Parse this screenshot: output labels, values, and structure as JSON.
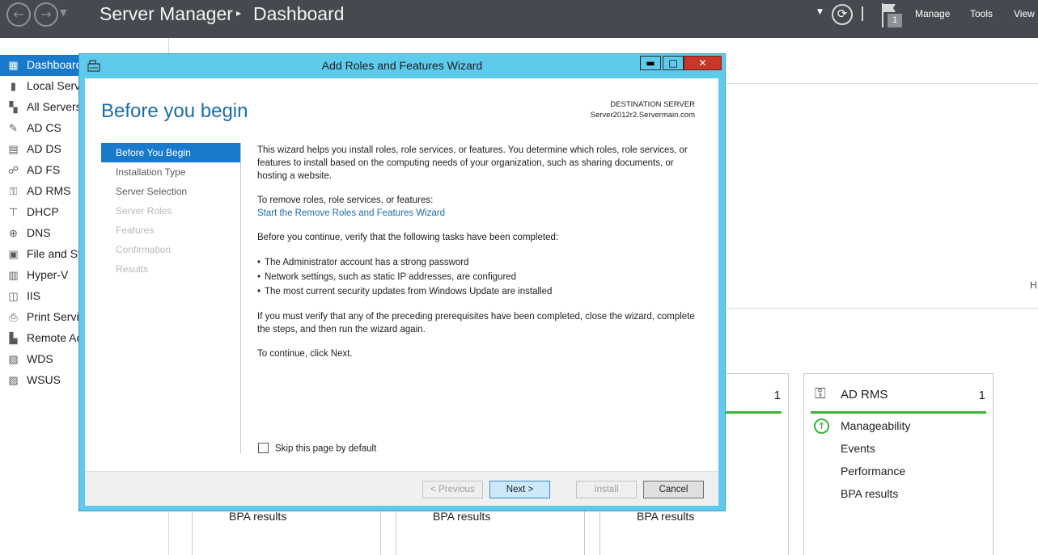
{
  "topbar": {
    "app_title": "Server Manager",
    "separator": "▸",
    "page_title": "Dashboard",
    "notification_count": "1",
    "menu": [
      "Manage",
      "Tools",
      "View"
    ]
  },
  "sidebar": {
    "items": [
      {
        "label": "Dashboard",
        "icon": "dashboard-grid-icon",
        "active": true
      },
      {
        "label": "Local Serve",
        "icon": "local-server-icon"
      },
      {
        "label": "All Servers",
        "icon": "all-servers-icon"
      },
      {
        "label": "AD CS",
        "icon": "ad-cs-icon"
      },
      {
        "label": "AD DS",
        "icon": "ad-ds-icon"
      },
      {
        "label": "AD FS",
        "icon": "ad-fs-icon"
      },
      {
        "label": "AD RMS",
        "icon": "ad-rms-icon"
      },
      {
        "label": "DHCP",
        "icon": "dhcp-icon"
      },
      {
        "label": "DNS",
        "icon": "dns-icon"
      },
      {
        "label": "File and St",
        "icon": "file-storage-icon"
      },
      {
        "label": "Hyper-V",
        "icon": "hyper-v-icon"
      },
      {
        "label": "IIS",
        "icon": "iis-icon"
      },
      {
        "label": "Print Servic",
        "icon": "print-icon"
      },
      {
        "label": "Remote Ac",
        "icon": "remote-access-icon"
      },
      {
        "label": "WDS",
        "icon": "wds-icon"
      },
      {
        "label": "WSUS",
        "icon": "wsus-icon"
      }
    ]
  },
  "main": {
    "clipped_text": "H",
    "tiles": [
      {
        "count": "1"
      },
      {
        "title": "AD RMS",
        "count": "1",
        "rows": [
          "Manageability",
          "Events",
          "Performance",
          "BPA results"
        ]
      }
    ],
    "bpa_label": "BPA results"
  },
  "wizard": {
    "title": "Add Roles and Features Wizard",
    "heading": "Before you begin",
    "destination_label": "DESTINATION SERVER",
    "destination_server": "Server2012r2.Servermain.com",
    "steps": [
      {
        "label": "Before You Begin",
        "state": "active"
      },
      {
        "label": "Installation Type",
        "state": "enabled"
      },
      {
        "label": "Server Selection",
        "state": "enabled"
      },
      {
        "label": "Server Roles",
        "state": "disabled"
      },
      {
        "label": "Features",
        "state": "disabled"
      },
      {
        "label": "Confirmation",
        "state": "disabled"
      },
      {
        "label": "Results",
        "state": "disabled"
      }
    ],
    "intro": "This wizard helps you install roles, role services, or features. You determine which roles, role services, or features to install based on the computing needs of your organization, such as sharing documents, or hosting a website.",
    "remove_label": "To remove roles, role services, or features:",
    "remove_link": "Start the Remove Roles and Features Wizard",
    "verify_text": "Before you continue, verify that the following tasks have been completed:",
    "tasks": [
      "The Administrator account has a strong password",
      "Network settings, such as static IP addresses, are configured",
      "The most current security updates from Windows Update are installed"
    ],
    "prereq_text": "If you must verify that any of the preceding prerequisites have been completed, close the wizard, complete the steps, and then run the wizard again.",
    "continue_text": "To continue, click Next.",
    "skip_label": "Skip this page by default",
    "buttons": {
      "previous": "< Previous",
      "next": "Next >",
      "install": "Install",
      "cancel": "Cancel"
    },
    "title_buttons": {
      "minimize": "▬",
      "maximize": "□",
      "close": "✕"
    }
  }
}
